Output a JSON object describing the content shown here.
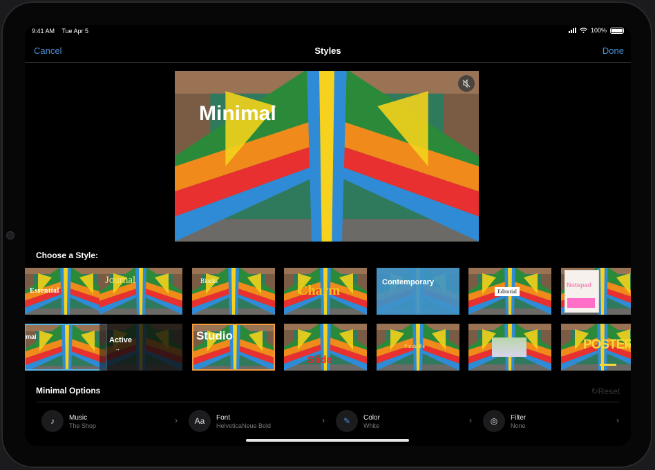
{
  "status": {
    "time": "9:41 AM",
    "date": "Tue Apr 5",
    "battery": "100%"
  },
  "nav": {
    "cancel": "Cancel",
    "title": "Styles",
    "done": "Done"
  },
  "preview": {
    "title": "Minimal"
  },
  "section_label": "Choose a Style:",
  "styles_row1": [
    {
      "label": "Essential"
    },
    {
      "label": "Journal"
    },
    {
      "label": "Blocks"
    },
    {
      "label": "Charm"
    },
    {
      "label": "Contemporary"
    },
    {
      "label": "Editorial"
    },
    {
      "label": "Notepad"
    }
  ],
  "styles_row2": [
    {
      "label": "mal"
    },
    {
      "label": "Active"
    },
    {
      "label": "Studio"
    },
    {
      "label": "Slide"
    },
    {
      "label": "Santa Fe"
    },
    {
      "label": ""
    },
    {
      "label": "POSTER"
    }
  ],
  "options": {
    "title": "Minimal Options",
    "reset": "Reset",
    "items": [
      {
        "name": "Music",
        "value": "The Shop",
        "icon": "music-note-icon",
        "glyph": "♪"
      },
      {
        "name": "Font",
        "value": "HelveticaNeue Bold",
        "icon": "font-icon",
        "glyph": "Aa"
      },
      {
        "name": "Color",
        "value": "White",
        "icon": "eyedropper-icon",
        "glyph": "✎"
      },
      {
        "name": "Filter",
        "value": "None",
        "icon": "filter-icon",
        "glyph": "◎"
      }
    ]
  },
  "colors": {
    "accent": "#4a90d9",
    "selected_border": "#59b6e9",
    "focused_border": "#f39a3a"
  }
}
